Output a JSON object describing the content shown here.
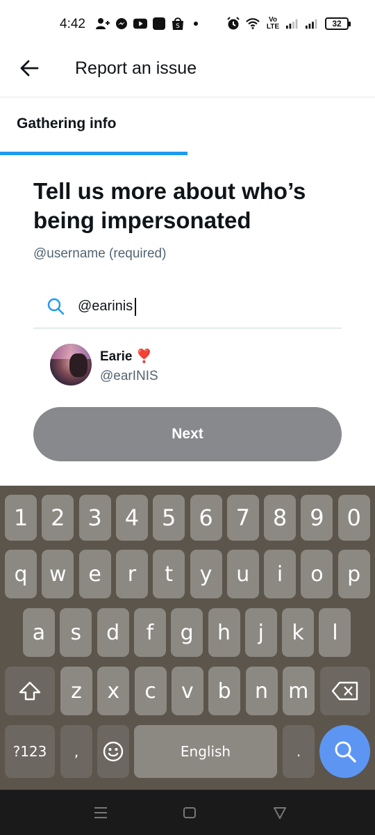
{
  "status_bar": {
    "time": "4:42",
    "volte": "Vo LTE",
    "battery": "32",
    "icons": [
      "person-add-icon",
      "messenger-icon",
      "youtube-icon",
      "app-icon",
      "shop-icon",
      "dot-icon",
      "alarm-icon",
      "wifi-icon",
      "signal-icon",
      "signal-icon"
    ]
  },
  "header": {
    "title": "Report an issue",
    "back_icon": "arrow-left-icon"
  },
  "section": {
    "label": "Gathering info",
    "progress": 0.5,
    "accent": "#1d9bf0"
  },
  "main": {
    "headline": "Tell us more about who’s being impersonated",
    "subtext": "@username (required)",
    "search": {
      "icon": "search-icon",
      "value": "@earinis"
    },
    "result": {
      "name": "Earie",
      "emoji": "❣️",
      "handle": "@earINIS"
    },
    "next_label": "Next"
  },
  "keyboard": {
    "row_numbers": [
      "1",
      "2",
      "3",
      "4",
      "5",
      "6",
      "7",
      "8",
      "9",
      "0"
    ],
    "row1": [
      "q",
      "w",
      "e",
      "r",
      "t",
      "y",
      "u",
      "i",
      "o",
      "p"
    ],
    "row2": [
      "a",
      "s",
      "d",
      "f",
      "g",
      "h",
      "j",
      "k",
      "l"
    ],
    "row3": [
      "z",
      "x",
      "c",
      "v",
      "b",
      "n",
      "m"
    ],
    "symbols_label": "?123",
    "comma": ",",
    "space_label": "English",
    "period": ".",
    "shift_icon": "shift-icon",
    "backspace_icon": "backspace-icon",
    "emoji_icon": "emoji-icon",
    "search_icon": "search-icon"
  },
  "colors": {
    "keyboard_bg": "#5b554c",
    "key_bg": "#8c8983",
    "next_button": "#87898c",
    "search_key": "#5d96f2"
  }
}
